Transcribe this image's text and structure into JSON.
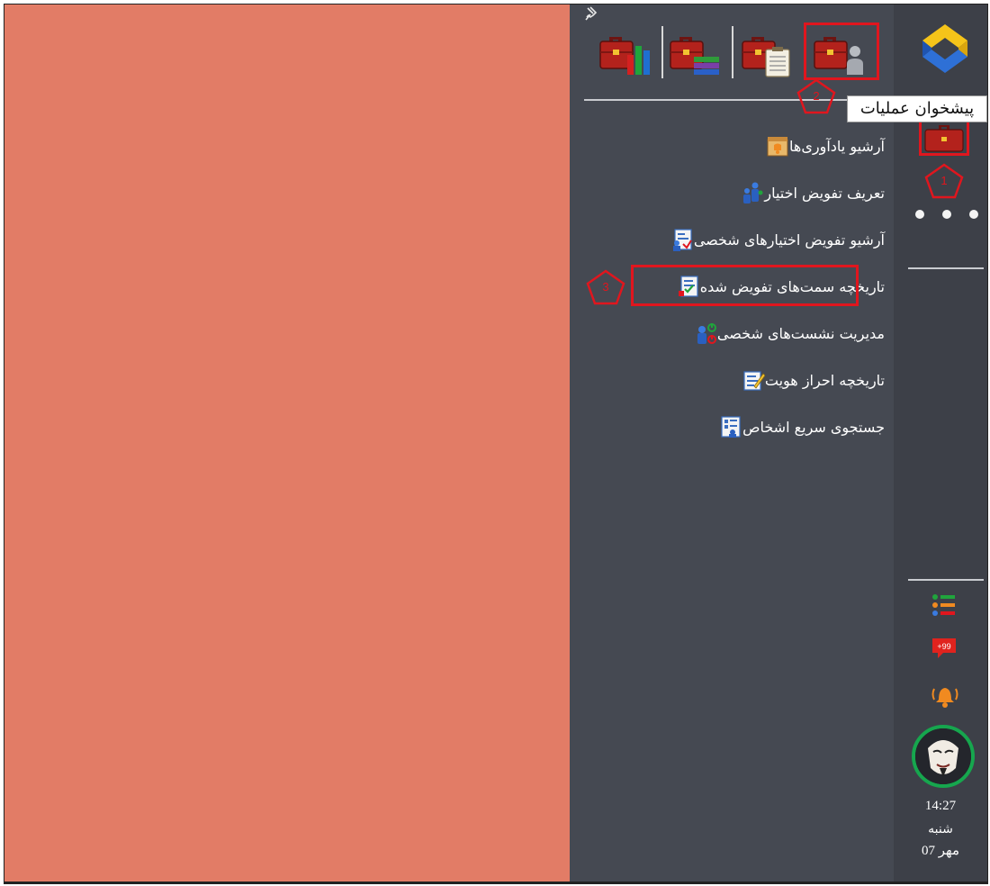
{
  "tooltip": "پیشخوان عملیات",
  "menu": {
    "items": [
      {
        "label": "آرشیو یادآوری‌ها",
        "icon": "reminder-archive-icon"
      },
      {
        "label": "تعریف تفویض اختیار",
        "icon": "delegation-definition-icon"
      },
      {
        "label": "آرشیو تفویض اختیارهای شخصی",
        "icon": "delegation-archive-icon"
      },
      {
        "label": "تاریخچه سمت‌های تفویض شده",
        "icon": "delegated-roles-history-icon"
      },
      {
        "label": "مدیریت نشست‌های شخصی",
        "icon": "session-management-icon"
      },
      {
        "label": "تاریخچه احراز هویت",
        "icon": "authentication-history-icon"
      },
      {
        "label": "جستجوی سریع اشخاص",
        "icon": "quick-person-search-icon"
      }
    ]
  },
  "callouts": {
    "one": "1",
    "two": "2",
    "three": "3"
  },
  "rail": {
    "badge": "+99",
    "time": "14:27",
    "day": "شنبه",
    "date": "07 مهر"
  },
  "colors": {
    "content_bg": "#e27c66",
    "panel_bg": "#454952",
    "rail_bg": "#3d4048",
    "callout_red": "#e0161e",
    "briefcase_red": "#b3221c"
  }
}
